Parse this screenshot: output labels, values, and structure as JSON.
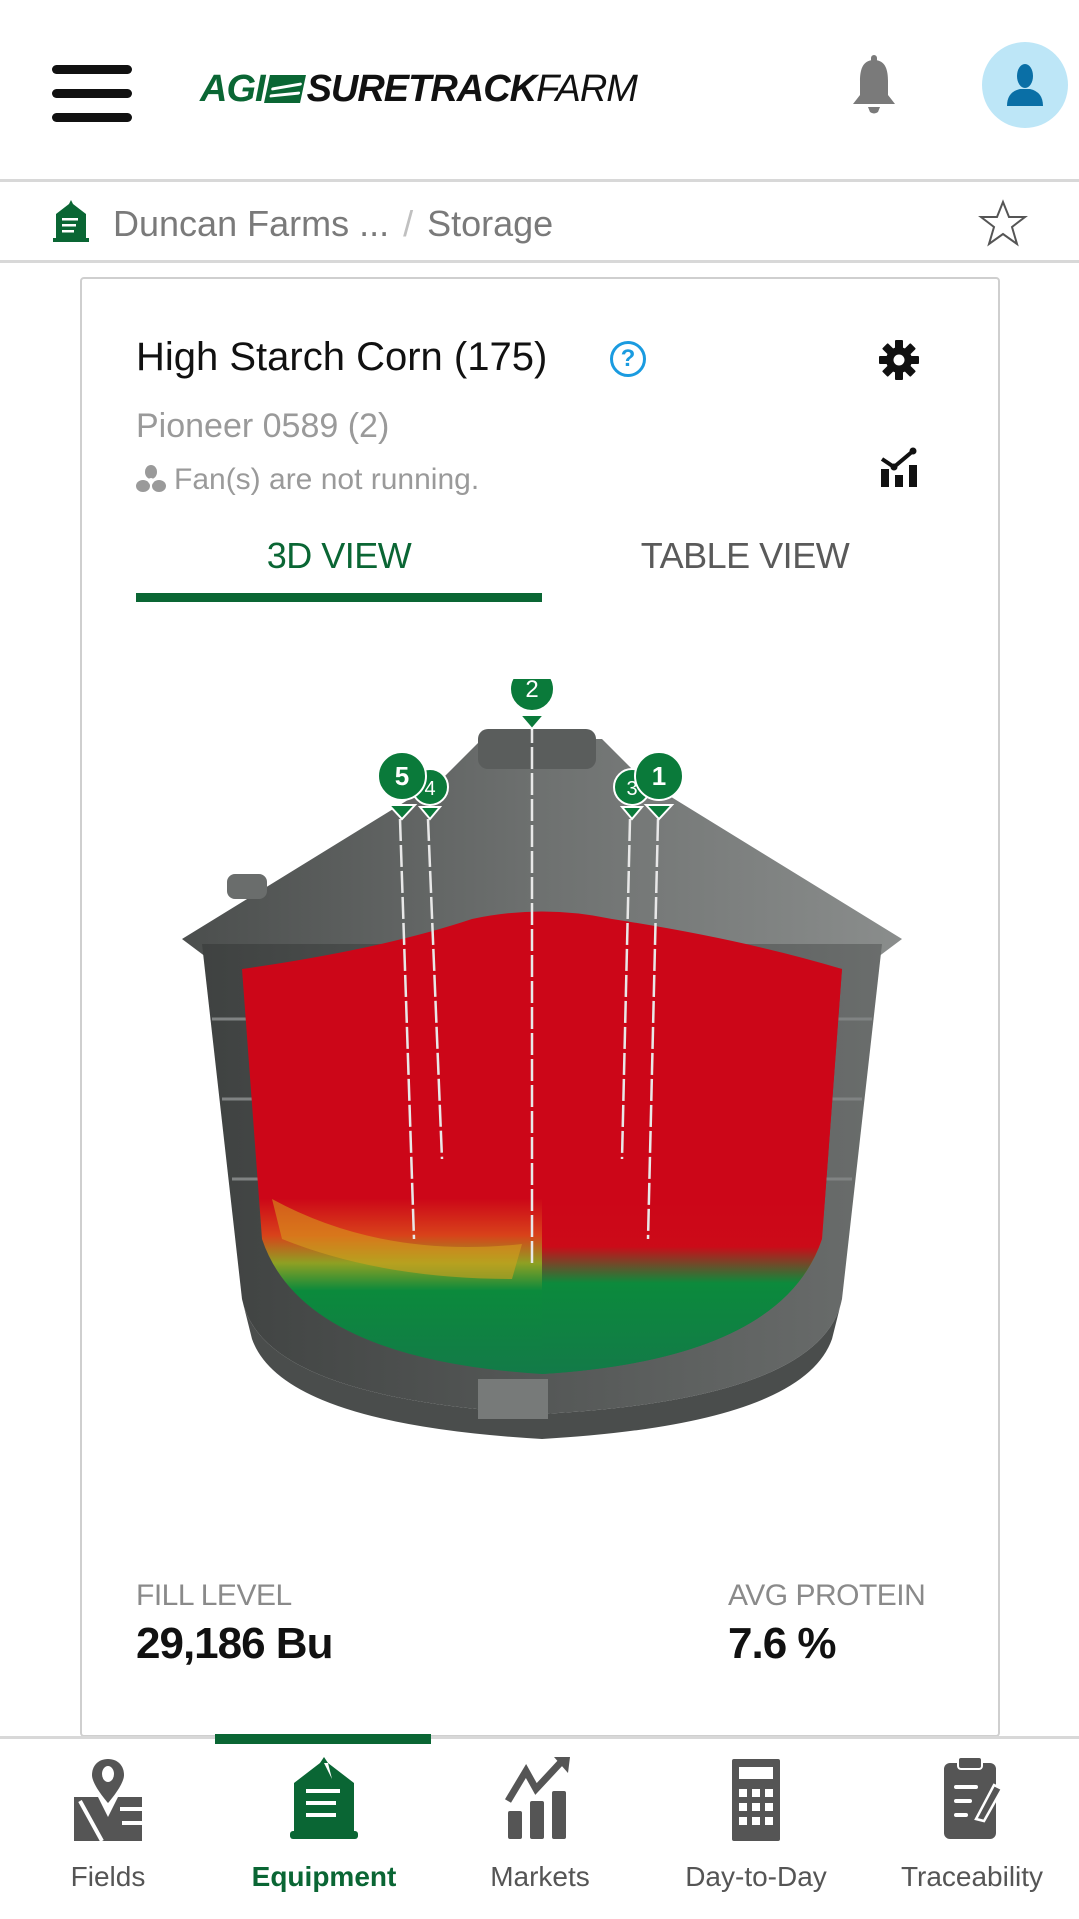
{
  "header": {
    "logo": {
      "part1": "AGI",
      "part2": "SURETRACK",
      "part3": "FARM"
    },
    "menu_icon": "hamburger-icon",
    "notifications_icon": "bell-icon",
    "profile_icon": "user-icon"
  },
  "breadcrumb": {
    "icon": "bin-icon",
    "items": [
      "Duncan Farms ...",
      "Storage"
    ],
    "separator": "/",
    "favorite_icon": "star-outline-icon"
  },
  "card": {
    "title": "High Starch Corn (175)",
    "help_icon_label": "?",
    "subtitle": "Pioneer 0589 (2)",
    "fan_status": "Fan(s) are not running.",
    "settings_icon": "gear-icon",
    "analytics_icon": "chart-icon",
    "tabs": [
      {
        "label": "3D VIEW",
        "active": true
      },
      {
        "label": "TABLE VIEW",
        "active": false
      }
    ],
    "bin_3d": {
      "cables": [
        "2",
        "5",
        "4",
        "3",
        "1"
      ],
      "colors": {
        "hot": "#cc0618",
        "warm": "#e07a14",
        "ok": "#0b8a3c",
        "steel": "#5e6160"
      }
    },
    "stats": [
      {
        "label": "FILL LEVEL",
        "value": "29,186 Bu"
      },
      {
        "label": "AVG PROTEIN",
        "value": "7.6 %"
      }
    ]
  },
  "bottom_nav": {
    "items": [
      {
        "label": "Fields",
        "icon": "map-pin-icon",
        "active": false
      },
      {
        "label": "Equipment",
        "icon": "bin-icon",
        "active": true
      },
      {
        "label": "Markets",
        "icon": "trend-chart-icon",
        "active": false
      },
      {
        "label": "Day-to-Day",
        "icon": "calculator-icon",
        "active": false
      },
      {
        "label": "Traceability",
        "icon": "clipboard-icon",
        "active": false
      }
    ]
  },
  "theme": {
    "brand_green": "#0a6634",
    "accent_blue": "#1a9be0",
    "avatar_bg": "#bde6f7"
  }
}
